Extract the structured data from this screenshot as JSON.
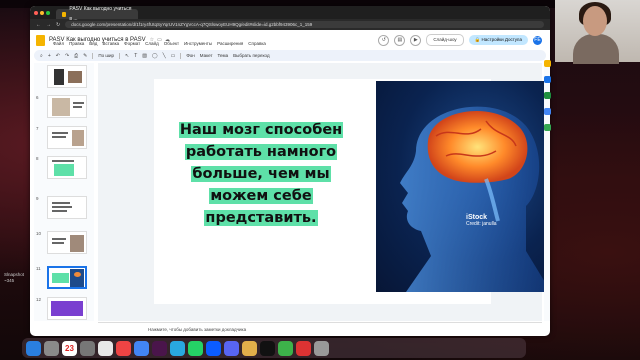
{
  "browser": {
    "tab_title": "PASV Как выгодно учиться в ...",
    "url": "docs.google.com/presentation/d/1f1ry4fUtqSyYqrUV1nZYgVccA-q7QSlswoyEUH9Qg/edit#slide=id.g2bbf943906c_1_159"
  },
  "docs": {
    "title": "PASV Как выгодно учиться в PASV",
    "menu": [
      "Файл",
      "Правка",
      "Вид",
      "Вставка",
      "Формат",
      "Слайд",
      "Объект",
      "Инструменты",
      "Расширения",
      "Справка"
    ],
    "slideshow_label": "Слайд-шоу",
    "share_label": "Настройки Доступа",
    "avatar_initials": "FE"
  },
  "toolbar": {
    "zoom_label": "По шир",
    "background_label": "Фон",
    "layout_label": "Макет",
    "theme_label": "Тема",
    "transition_label": "Выбрать переход"
  },
  "filmstrip": {
    "numbers": [
      "",
      "6",
      "7",
      "8",
      "9",
      "10",
      "11",
      "12"
    ],
    "active_index": 6
  },
  "slide": {
    "headline_lines": [
      "Наш мозг способен",
      "работать намного",
      "больше, чем мы",
      "можем себе",
      "представить."
    ],
    "highlight_color": "#5ee0a8",
    "photo": {
      "watermark": "iStock",
      "credit": "Credit: janulla"
    }
  },
  "notes": {
    "placeholder": "Нажмите, чтобы добавить заметки докладчика"
  },
  "desktop": {
    "label_1": "Slnapshot",
    "label_2": "~345"
  },
  "dock": {
    "calendar_day": "23"
  }
}
